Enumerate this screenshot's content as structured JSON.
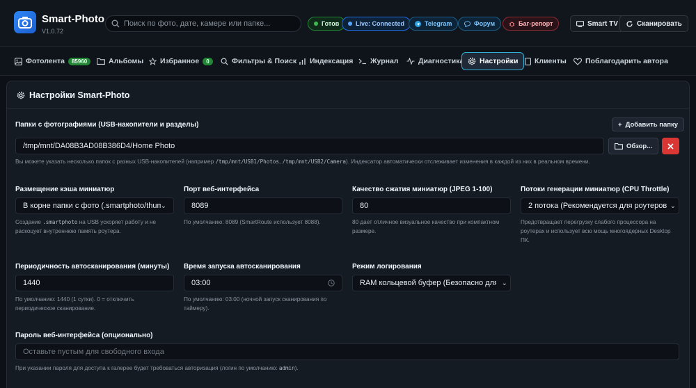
{
  "header": {
    "title": "Smart-Photo",
    "version": "V1.0.72",
    "search_placeholder": "Поиск по фото, дате, камере или папке...",
    "status": {
      "ready": "Готов",
      "live": "Live: Connected"
    },
    "links": {
      "telegram": "Telegram",
      "forum": "Форум",
      "bug": "Баг-репорт"
    },
    "buttons": {
      "smart_tv": "Smart TV",
      "scan": "Сканировать"
    }
  },
  "tabs": [
    {
      "label": "Фотолента",
      "badge": "85960",
      "icon": "image-icon"
    },
    {
      "label": "Альбомы",
      "icon": "folder-icon"
    },
    {
      "label": "Избранное",
      "badge": "0",
      "icon": "star-icon"
    },
    {
      "label": "Фильтры & Поиск",
      "icon": "search-icon"
    },
    {
      "label": "Индексация",
      "icon": "bar-chart-icon"
    },
    {
      "label": "Журнал",
      "icon": "terminal-icon"
    },
    {
      "label": "Диагностика",
      "icon": "pulse-icon"
    },
    {
      "label": "Настройки",
      "icon": "gear-icon",
      "active": true
    },
    {
      "label": "Клиенты",
      "icon": "device-icon"
    },
    {
      "label": "Поблагодарить автора",
      "icon": "heart-icon"
    }
  ],
  "settings": {
    "title": "Настройки Smart-Photo",
    "folders": {
      "label": "Папки с фотографиями (USB-накопители и разделы)",
      "add_button": "Добавить папку",
      "path": "/tmp/mnt/DA08B3AD08B386D4/Home Photo",
      "browse_button": "Обзор...",
      "help_pre": "Вы можете указать несколько папок с разных USB-накопителей (например ",
      "help_code1": "/tmp/mnt/USB1/Photos",
      "help_mid": ", ",
      "help_code2": "/tmp/mnt/USB2/Camera",
      "help_post": "). Индексатор автоматически отслеживает изменения в каждой из них в реальном времени."
    },
    "cache": {
      "label": "Размещение кэша миниатюр",
      "value": "В корне папки с фото (.smartphoto/thumbs)",
      "help_pre": "Создание ",
      "help_code": ".smartphoto",
      "help_post": " на USB ускоряет работу и не раскоцует внутреннюю память роутера."
    },
    "port": {
      "label": "Порт веб-интерфейса",
      "value": "8089",
      "help": "По умолчанию: 8089 (SmartRoute использует 8088)."
    },
    "quality": {
      "label": "Качество сжатия миниатюр (JPEG 1-100)",
      "value": "80",
      "help": "80 дает отличное визуальное качество при компактном размере."
    },
    "threads": {
      "label": "Потоки генерации миниатюр (CPU Throttle)",
      "value": "2 потока (Рекомендуется для роутеров Keenetic)",
      "help": "Предотвращает перегрузку слабого процессора на роутерах и использует всю мощь многоядерных Desktop ПК."
    },
    "interval": {
      "label": "Периодичность автосканирования (минуты)",
      "value": "1440",
      "help": "По умолчанию: 1440 (1 сутки). 0 = отключить периодическое сканирование."
    },
    "start_time": {
      "label": "Время запуска автосканирования",
      "value": "03:00",
      "help": "По умолчанию: 03:00 (ночной запуск сканирования по таймеру)."
    },
    "log_mode": {
      "label": "Режим логирования",
      "value": "RAM кольцевой буфер (Безопасно для флеш-памяти)"
    },
    "password": {
      "label": "Пароль веб-интерфейса (опционально)",
      "placeholder": "Оставьте пустым для свободного входа",
      "help_pre": "При указании пароля для доступа к галерее будет требоваться авторизация (логин по умолчанию: ",
      "help_code": "admin",
      "help_post": ")."
    }
  },
  "colors": {
    "accent": "#30b3d6",
    "success": "#238636",
    "danger": "#da3633",
    "brand": "#2f86f6"
  }
}
